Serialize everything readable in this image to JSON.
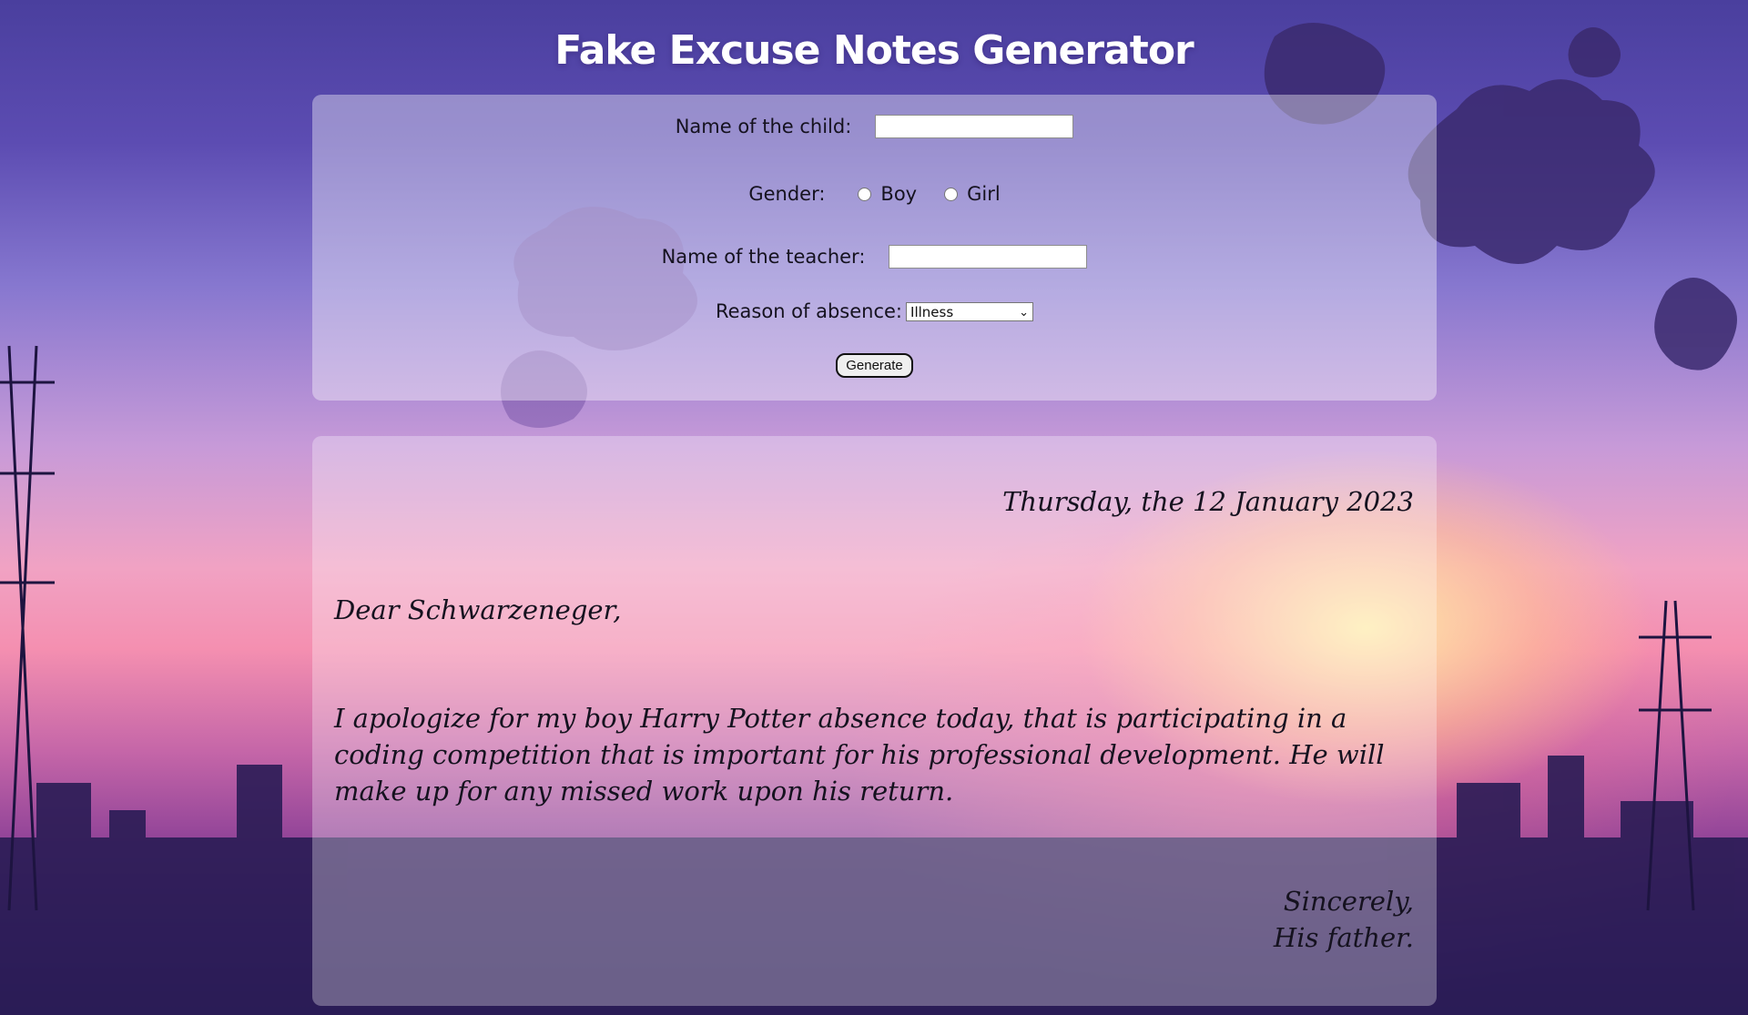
{
  "title": "Fake Excuse Notes Generator",
  "form": {
    "child_label": "Name of the child:",
    "child_value": "",
    "gender_label": "Gender:",
    "gender_options": [
      "Boy",
      "Girl"
    ],
    "teacher_label": "Name of the teacher:",
    "teacher_value": "",
    "reason_label": "Reason of absence:",
    "reason_selected": "Illness",
    "generate_label": "Generate"
  },
  "note": {
    "date": "Thursday, the 12 January 2023",
    "greeting": "Dear Schwarzeneger,",
    "body": "I apologize for my boy Harry Potter absence today, that is participating in a coding competition that is important for his professional development. He will make up for any missed work upon his return.",
    "closing": "Sincerely,",
    "signature": "His father."
  },
  "colors": {
    "panel": "#ffffff",
    "text": "#15121f",
    "title": "#ffffff"
  }
}
